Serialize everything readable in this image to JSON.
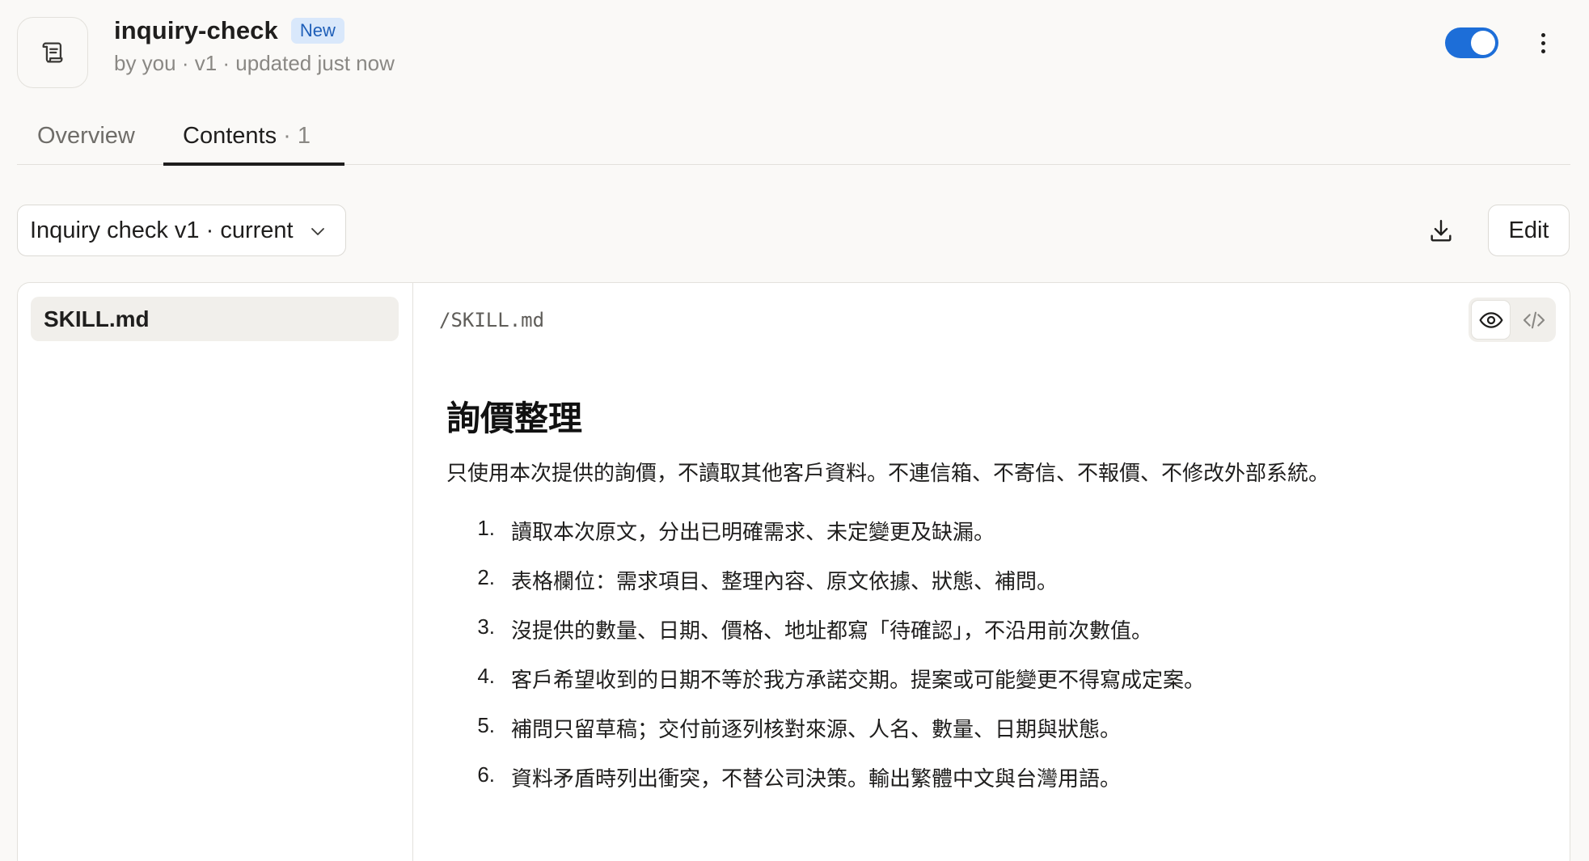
{
  "header": {
    "icon": "scroll-icon",
    "title": "inquiry-check",
    "badge": "New",
    "subtitle": "by you · v1 · updated just now",
    "enabled": true,
    "accent_color": "#1d6ed8",
    "more_icon": "more-vertical-icon"
  },
  "tabs": [
    {
      "label": "Overview",
      "count": "",
      "active": false
    },
    {
      "label": "Contents",
      "count": " · 1",
      "active": true
    }
  ],
  "toolbar": {
    "version_label": "Inquiry check v1 · current",
    "download_icon": "download-icon",
    "edit_label": "Edit"
  },
  "files": [
    {
      "name": "SKILL.md",
      "selected": true
    }
  ],
  "viewer": {
    "path": "/SKILL.md",
    "view_mode": "preview",
    "heading": "詢價整理",
    "intro": "只使用本次提供的詢價，不讀取其他客戶資料。不連信箱、不寄信、不報價、不修改外部系統。",
    "steps": [
      {
        "num": "1.",
        "text": "讀取本次原文，分出已明確需求、未定變更及缺漏。"
      },
      {
        "num": "2.",
        "text": "表格欄位：需求項目、整理內容、原文依據、狀態、補問。"
      },
      {
        "num": "3.",
        "text": "沒提供的數量、日期、價格、地址都寫「待確認」，不沿用前次數值。"
      },
      {
        "num": "4.",
        "text": "客戶希望收到的日期不等於我方承諾交期。提案或可能變更不得寫成定案。"
      },
      {
        "num": "5.",
        "text": "補問只留草稿；交付前逐列核對來源、人名、數量、日期與狀態。"
      },
      {
        "num": "6.",
        "text": "資料矛盾時列出衝突，不替公司決策。輸出繁體中文與台灣用語。"
      }
    ]
  }
}
